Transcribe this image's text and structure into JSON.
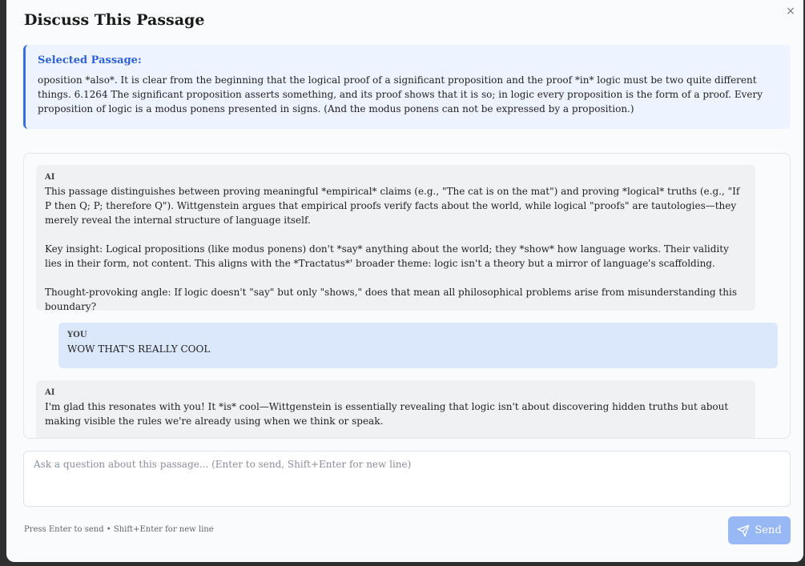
{
  "modal": {
    "title": "Discuss This Passage",
    "close_label": "×"
  },
  "passage": {
    "label": "Selected Passage:",
    "text": "oposition *also*. It is clear from the beginning that the logical proof of a significant proposition and the proof *in* logic must be two quite different things.  6.1264 The significant proposition asserts something, and its proof shows that it is so; in logic every proposition is the form of a proof. Every proposition of logic is a modus ponens presented in signs. (And the modus ponens can not be expressed by a proposition.)"
  },
  "chat": {
    "messages": [
      {
        "sender": "AI",
        "paragraphs": [
          "This passage distinguishes between proving meaningful *empirical* claims (e.g., \"The cat is on the mat\") and proving *logical* truths (e.g., \"If P then Q; P; therefore Q\"). Wittgenstein argues that empirical proofs verify facts about the world, while logical \"proofs\" are tautologies—they merely reveal the internal structure of language itself.",
          "Key insight: Logical propositions (like modus ponens) don't *say* anything about the world; they *show* how language works. Their validity lies in their form, not content. This aligns with the *Tractatus*' broader theme: logic isn't a theory but a mirror of language's scaffolding.",
          "Thought-provoking angle: If logic doesn't \"say\" but only \"shows,\" does that mean all philosophical problems arise from misunderstanding this boundary?"
        ]
      },
      {
        "sender": "YOU",
        "paragraphs": [
          "WOW THAT'S REALLY COOL"
        ]
      },
      {
        "sender": "AI",
        "paragraphs": [
          "I'm glad this resonates with you! It *is* cool—Wittgenstein is essentially revealing that logic isn't about discovering hidden truths but about making visible the rules we're already using when we think or speak."
        ]
      }
    ]
  },
  "input": {
    "placeholder": "Ask a question about this passage... (Enter to send, Shift+Enter for new line)",
    "value": ""
  },
  "footer": {
    "hint": "Press Enter to send • Shift+Enter for new line",
    "send_label": "Send"
  },
  "icons": {
    "close": "close-icon",
    "send": "send-icon"
  },
  "colors": {
    "accent": "#3b6fe0",
    "send_button": "#97b8f4",
    "passage_bg": "#eef4ff",
    "user_msg_bg": "#dbe8fb",
    "ai_msg_bg": "#f0f1f3"
  }
}
